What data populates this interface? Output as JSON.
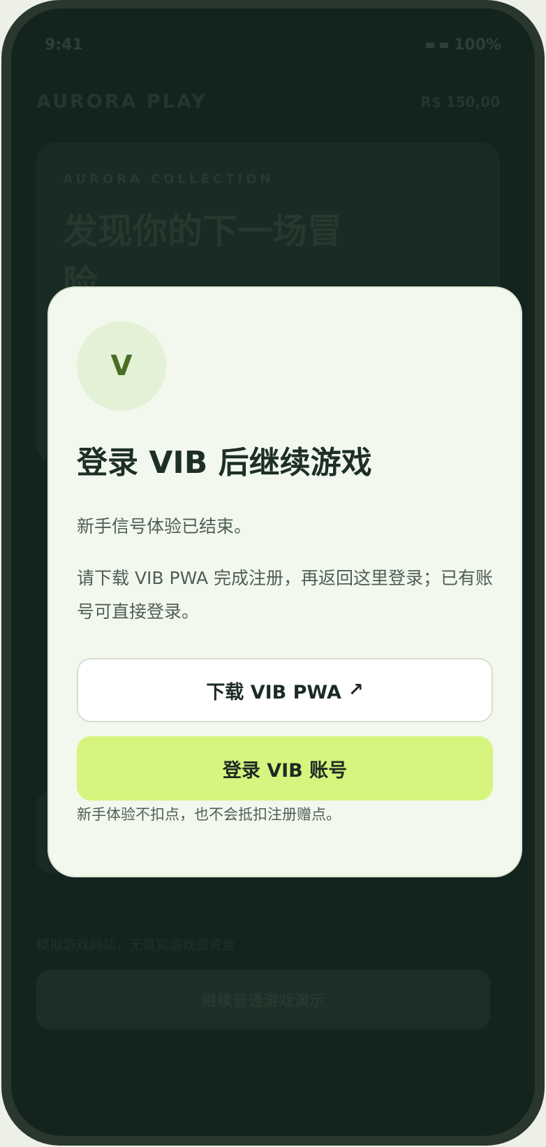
{
  "status_bar": {
    "time": "9:41",
    "battery": "100%"
  },
  "app": {
    "brand": "AURORA PLAY",
    "balance": "R$ 150,00",
    "hero_eyebrow": "AURORA COLLECTION",
    "hero_title": "发现你的下一场冒险",
    "disclaimer": "模拟游戏网站，无真实游戏或资金",
    "continue_label": "继续普通游戏演示"
  },
  "modal": {
    "avatar_letter": "V",
    "title": "登录 VIB 后继续游戏",
    "message_1": "新手信号体验已结束。",
    "message_2": "请下载 VIB PWA 完成注册，再返回这里登录；已有账号可直接登录。",
    "download_label": "下载 VIB PWA",
    "download_icon": "↗",
    "login_label": "登录 VIB 账号",
    "note": "新手体验不扣点，也不会抵扣注册赠点。"
  },
  "colors": {
    "accent": "#d6f57e",
    "background": "#13241e",
    "modal_surface": "#f3f8ee"
  }
}
